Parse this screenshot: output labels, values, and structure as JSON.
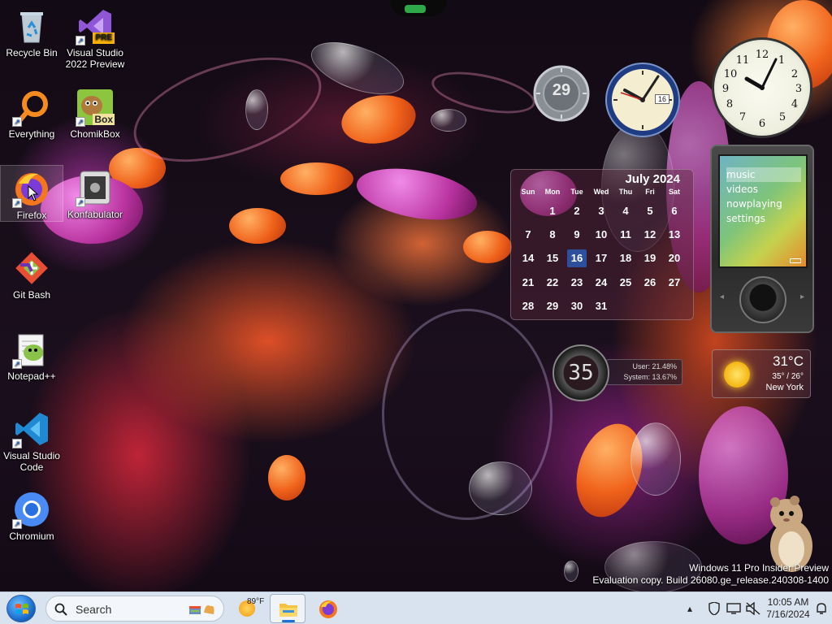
{
  "desktop": {
    "icons": [
      {
        "label": "Recycle Bin",
        "icon": "recycle-bin-icon",
        "shortcut": false
      },
      {
        "label": "Visual Studio 2022 Preview",
        "icon": "visual-studio-preview-icon",
        "shortcut": true,
        "badge": "PRE"
      },
      {
        "label": "Everything",
        "icon": "everything-search-icon",
        "shortcut": true
      },
      {
        "label": "ChomikBox",
        "icon": "chomikbox-icon",
        "shortcut": true,
        "badge": "Box"
      },
      {
        "label": "Firefox",
        "icon": "firefox-icon",
        "shortcut": true
      },
      {
        "label": "Konfabulator",
        "icon": "konfabulator-icon",
        "shortcut": true
      },
      {
        "label": "Git Bash",
        "icon": "git-bash-icon",
        "shortcut": false
      },
      {
        "label": "Notepad++",
        "icon": "notepad-plus-plus-icon",
        "shortcut": true
      },
      {
        "label": "Visual Studio Code",
        "icon": "vscode-icon",
        "shortcut": true
      },
      {
        "label": "Chromium",
        "icon": "chromium-icon",
        "shortcut": true
      }
    ]
  },
  "gadgets": {
    "calendar": {
      "month_title": "July 2024",
      "weekdays": [
        "Sun",
        "Mon",
        "Tue",
        "Wed",
        "Thu",
        "Fri",
        "Sat"
      ],
      "days": [
        "",
        "1",
        "2",
        "3",
        "4",
        "5",
        "6",
        "7",
        "8",
        "9",
        "10",
        "11",
        "12",
        "13",
        "14",
        "15",
        "16",
        "17",
        "18",
        "19",
        "20",
        "21",
        "22",
        "23",
        "24",
        "25",
        "26",
        "27",
        "28",
        "29",
        "30",
        "31"
      ],
      "today": "16"
    },
    "date_dial": {
      "value": "29"
    },
    "analog_clock_small": {
      "date": "16"
    },
    "cpu_meter": {
      "dial_value": "35",
      "user": "User: 21.48%",
      "system": "System: 13.67%"
    },
    "media_player": {
      "menu": [
        "music",
        "videos",
        "nowplaying",
        "settings"
      ],
      "selected": "music"
    },
    "weather": {
      "temperature": "31°C",
      "range": "35° / 26°",
      "city": "New York",
      "condition_icon": "sun-icon"
    }
  },
  "watermark": {
    "line1": "Windows 11 Pro Insider Preview",
    "line2": "Evaluation copy. Build 26080.ge_release.240308-1400"
  },
  "taskbar": {
    "search_placeholder": "Search",
    "weather_temp": "89°F",
    "clock_time": "10:05 AM",
    "clock_date": "7/16/2024",
    "pinned": [
      {
        "name": "file-explorer",
        "active": true
      },
      {
        "name": "firefox",
        "active": false
      }
    ]
  },
  "colors": {
    "taskbar_bg": "#d9e3ef",
    "calendar_today": "#2e4f9e",
    "accent_orange": "#f0621b",
    "accent_purple": "#b9339f"
  }
}
